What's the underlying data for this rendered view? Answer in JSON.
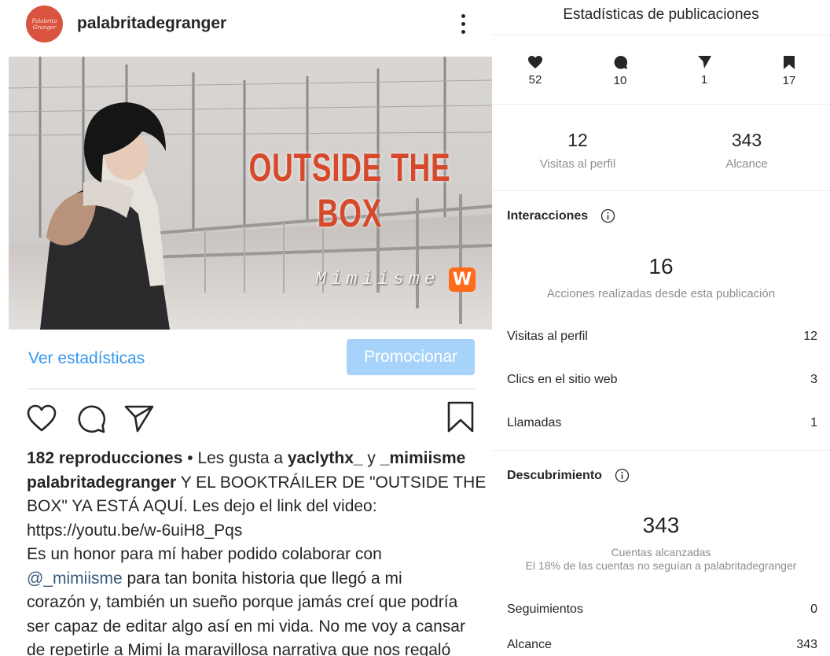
{
  "post": {
    "username": "palabritadegranger",
    "avatar_text": "Palabrita Granger",
    "media": {
      "title_line1": "OUTSIDE THE",
      "title_line2": "BOX",
      "subtitle": "Mimiisme",
      "badge": "W"
    },
    "insights_link": "Ver estadísticas",
    "promote_button": "Promocionar",
    "caption": {
      "views": "182 reproducciones",
      "likes_prefix": " • Les gusta a ",
      "liker1": "yaclythx_",
      "likes_and": " y ",
      "liker2": "_mimiisme",
      "author": "palabritadegranger",
      "line1_rest": " Y EL BOOKTRÁILER DE \"OUTSIDE THE",
      "line2": "BOX\" YA ESTÁ AQUÍ. Les dejo el link del video:",
      "line3": "https://youtu.be/w-6uiH8_Pqs",
      "line4": "Es un honor para mí haber podido colaborar con",
      "mention": "@_mimiisme",
      "line5_rest": " para tan bonita historia que llegó a mi",
      "line6": "corazón y, también un sueño porque jamás creí que podría",
      "line7": "ser capaz de editar algo así en mi vida. No me voy a cansar",
      "line8": "de repetirle a Mimi la maravillosa narrativa que nos regaló"
    }
  },
  "panel": {
    "title": "Estadísticas de publicaciones",
    "metrics": [
      {
        "icon": "heart-icon",
        "value": "52"
      },
      {
        "icon": "comment-icon",
        "value": "10"
      },
      {
        "icon": "share-icon",
        "value": "1"
      },
      {
        "icon": "bookmark-icon",
        "value": "17"
      }
    ],
    "profile_visits": {
      "value": "12",
      "label": "Visitas al perfil"
    },
    "reach": {
      "value": "343",
      "label": "Alcance"
    },
    "interactions": {
      "title": "Interacciones",
      "value": "16",
      "label": "Acciones realizadas desde esta publicación",
      "rows": [
        {
          "label": "Visitas al perfil",
          "value": "12"
        },
        {
          "label": "Clics en el sitio web",
          "value": "3"
        },
        {
          "label": "Llamadas",
          "value": "1"
        }
      ]
    },
    "discovery": {
      "title": "Descubrimiento",
      "value": "343",
      "label": "Cuentas alcanzadas",
      "sublabel": "El 18% de las cuentas no seguían a palabritadegranger",
      "rows": [
        {
          "label": "Seguimientos",
          "value": "0"
        },
        {
          "label": "Alcance",
          "value": "343"
        }
      ]
    }
  },
  "colors": {
    "link_blue": "#3897f0",
    "promote_disabled": "#a7d3fa",
    "avatar_red": "#d9533f",
    "title_red": "#d6492a",
    "wattpad_orange": "#ff6b1a"
  }
}
